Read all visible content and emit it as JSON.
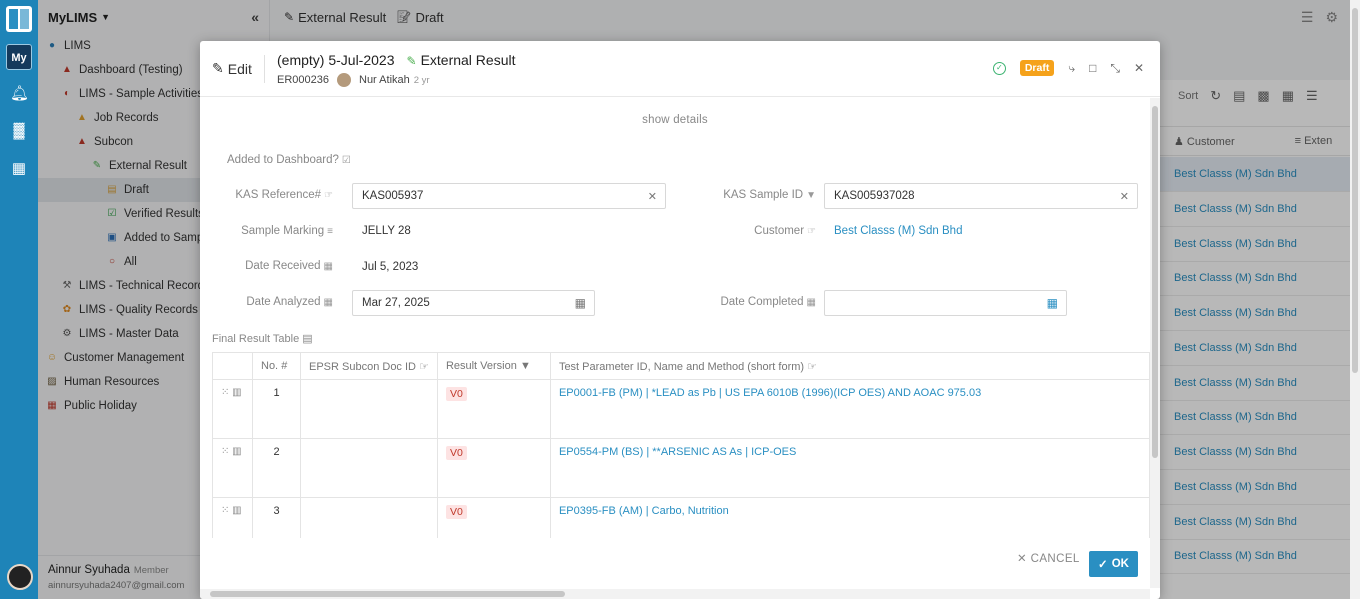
{
  "app": {
    "name": "MyLIMS",
    "rail_badge": "My"
  },
  "sidebar": {
    "items": [
      {
        "label": "LIMS",
        "icon": "globe-icon",
        "indent": 0
      },
      {
        "label": "Dashboard (Testing)",
        "icon": "dashboard-icon",
        "indent": 1
      },
      {
        "label": "LIMS - Sample Activities",
        "icon": "flask-icon",
        "indent": 1
      },
      {
        "label": "Job Records",
        "icon": "tent-icon",
        "indent": 2
      },
      {
        "label": "Subcon",
        "icon": "person-icon",
        "indent": 2
      },
      {
        "label": "External Result",
        "icon": "pencil-icon",
        "indent": 3
      },
      {
        "label": "Draft",
        "icon": "memo-icon",
        "indent": 4,
        "active": true
      },
      {
        "label": "Verified Results",
        "icon": "check-box-icon",
        "indent": 4
      },
      {
        "label": "Added to Sample",
        "icon": "id-card-icon",
        "indent": 4
      },
      {
        "label": "All",
        "icon": "circle-icon",
        "indent": 4
      },
      {
        "label": "LIMS - Technical Records F",
        "icon": "tools-icon",
        "indent": 1
      },
      {
        "label": "LIMS - Quality Records For",
        "icon": "flower-icon",
        "indent": 1
      },
      {
        "label": "LIMS - Master Data",
        "icon": "gear-icon",
        "indent": 1
      },
      {
        "label": "Customer Management",
        "icon": "smile-icon",
        "indent": 0
      },
      {
        "label": "Human Resources",
        "icon": "picture-icon",
        "indent": 0
      },
      {
        "label": "Public Holiday",
        "icon": "calendar-icon",
        "indent": 0
      }
    ],
    "user": {
      "name": "Ainnur Syuhada",
      "role": "Member",
      "email": "ainnursyuhada2407@gmail.com"
    }
  },
  "topbar": {
    "crumb1": "External Result",
    "crumb2": "Draft"
  },
  "background": {
    "sort_label": "Sort",
    "col_customer": "Customer",
    "col_ext": "Exten",
    "rows": [
      "Best Classs (M) Sdn Bhd",
      "Best Classs (M) Sdn Bhd",
      "Best Classs (M) Sdn Bhd",
      "Best Classs (M) Sdn Bhd",
      "Best Classs (M) Sdn Bhd",
      "Best Classs (M) Sdn Bhd",
      "Best Classs (M) Sdn Bhd",
      "Best Classs (M) Sdn Bhd",
      "Best Classs (M) Sdn Bhd",
      "Best Classs (M) Sdn Bhd",
      "Best Classs (M) Sdn Bhd",
      "Best Classs (M) Sdn Bhd"
    ]
  },
  "modal": {
    "mode": "Edit",
    "title": "(empty) 5-Jul-2023",
    "type": "External Result",
    "record_id": "ER000236",
    "author": "Nur Atikah",
    "ago": "2 yr",
    "status": "Draft",
    "show_details": "show details",
    "fields": {
      "added_to_dashboard": "Added to Dashboard?",
      "kas_ref_label": "KAS Reference#",
      "kas_ref_value": "KAS005937",
      "kas_sample_label": "KAS Sample ID",
      "kas_sample_value": "KAS005937028",
      "sample_marking_label": "Sample Marking",
      "sample_marking_value": "JELLY 28",
      "customer_label": "Customer",
      "customer_value": "Best Classs (M) Sdn Bhd",
      "date_received_label": "Date Received",
      "date_received_value": "Jul 5, 2023",
      "date_analyzed_label": "Date Analyzed",
      "date_analyzed_value": "Mar 27, 2025",
      "date_completed_label": "Date Completed",
      "date_completed_value": ""
    },
    "table": {
      "title": "Final Result Table",
      "headers": {
        "no": "No.",
        "epsr": "EPSR Subcon Doc ID",
        "version": "Result Version",
        "param": "Test Parameter ID, Name and Method (short form)"
      },
      "rows": [
        {
          "no": "1",
          "epsr": "",
          "version": "V0",
          "param": "EP0001-FB (PM) | *LEAD as Pb | US EPA 6010B (1996)(ICP OES) AND AOAC 975.03"
        },
        {
          "no": "2",
          "epsr": "",
          "version": "V0",
          "param": "EP0554-PM (BS) | **ARSENIC AS As | ICP-OES"
        },
        {
          "no": "3",
          "epsr": "",
          "version": "V0",
          "param": "EP0395-FB (AM) | Carbo, Nutrition"
        }
      ]
    },
    "cancel_label": "CANCEL",
    "ok_label": "OK"
  }
}
